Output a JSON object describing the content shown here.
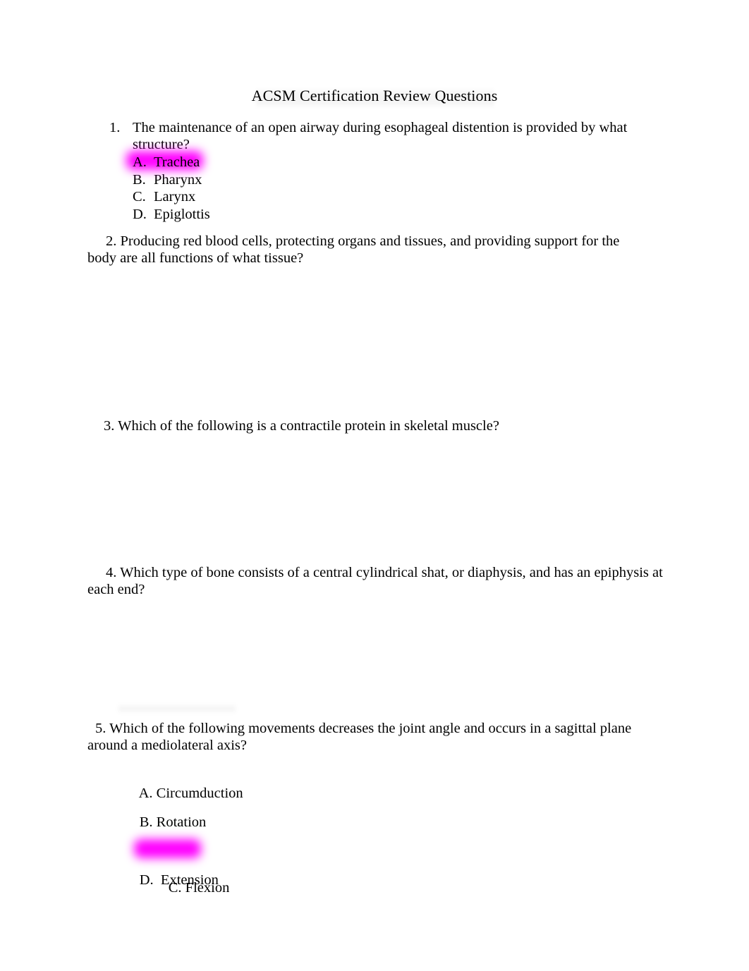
{
  "document": {
    "title": "ACSM Certification Review Questions",
    "highlight_color": "#ff00ff",
    "text_color": "#000000",
    "page_background": "#ffffff"
  },
  "questions": [
    {
      "number": "1.",
      "text": "The maintenance of an open airway during esophageal distention is provided by what structure?",
      "options": [
        {
          "letter": "A.",
          "text": "Trachea",
          "highlighted": true
        },
        {
          "letter": "B.",
          "text": "Pharynx",
          "highlighted": false
        },
        {
          "letter": "C.",
          "text": "Larynx",
          "highlighted": false
        },
        {
          "letter": "D.",
          "text": "Epiglottis",
          "highlighted": false
        }
      ]
    },
    {
      "number": "2.",
      "text": "2. Producing red blood cells, protecting organs and tissues, and providing support for the body are all functions of what tissue?",
      "options": []
    },
    {
      "number": "3.",
      "text": "3. Which of the following is a contractile protein in skeletal muscle?",
      "options": []
    },
    {
      "number": "4.",
      "text": "4. Which type of bone consists of a central cylindrical shat, or diaphysis, and has an epiphysis at each end?",
      "options": []
    },
    {
      "number": "5.",
      "text": "5. Which of the following movements decreases the joint angle and occurs in a sagittal plane around a mediolateral axis?",
      "options": [
        {
          "letter": "A.",
          "text": "A. Circumduction",
          "highlighted": false
        },
        {
          "letter": "B.",
          "text": "B. Rotation",
          "highlighted": false
        },
        {
          "letter": "C.",
          "text": "C. Flexion",
          "highlighted": true
        },
        {
          "letter": "D.",
          "text": "D.  Extension",
          "highlighted": false
        }
      ]
    }
  ]
}
